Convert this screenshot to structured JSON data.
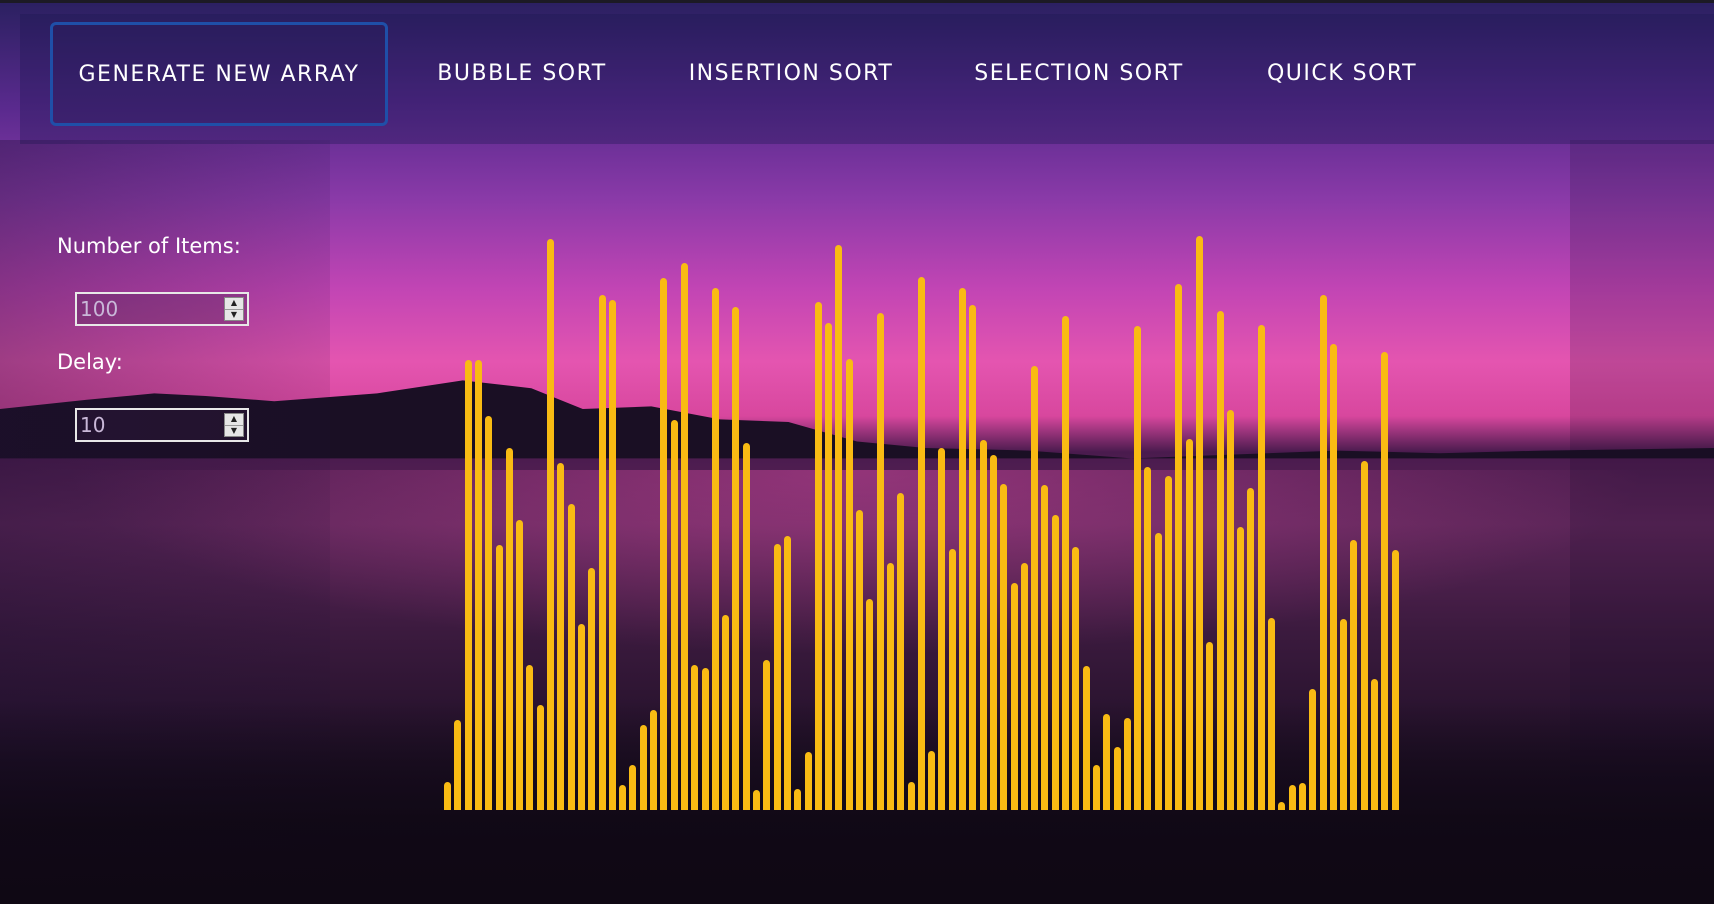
{
  "nav": {
    "buttons": [
      {
        "label": "GENERATE NEW ARRAY",
        "active": true
      },
      {
        "label": "BUBBLE SORT",
        "active": false
      },
      {
        "label": "INSERTION SORT",
        "active": false
      },
      {
        "label": "SELECTION SORT",
        "active": false
      },
      {
        "label": "QUICK SORT",
        "active": false
      }
    ]
  },
  "controls": {
    "items_label": "Number of Items:",
    "items_value": "100",
    "delay_label": "Delay:",
    "delay_value": "10"
  },
  "colors": {
    "bar": "#f9bb13",
    "active_border": "#1f4fa8"
  },
  "bars": [
    28,
    90,
    450,
    450,
    394,
    265,
    362,
    290,
    145,
    105,
    571,
    347,
    306,
    186,
    242,
    515,
    510,
    25,
    45,
    85,
    100,
    532,
    390,
    547,
    145,
    142,
    522,
    195,
    503,
    367,
    20,
    150,
    266,
    274,
    21,
    58,
    508,
    487,
    565,
    451,
    300,
    211,
    497,
    247,
    317,
    28,
    533,
    59,
    362,
    261,
    522,
    505,
    370,
    355,
    326,
    227,
    247,
    444,
    325,
    295,
    494,
    263,
    144,
    45,
    96,
    63,
    92,
    484,
    343,
    277,
    334,
    526,
    371,
    574,
    168,
    499,
    400,
    283,
    322,
    485,
    192,
    8,
    25,
    27,
    121,
    515,
    466,
    191,
    270,
    349,
    131,
    458,
    260
  ]
}
